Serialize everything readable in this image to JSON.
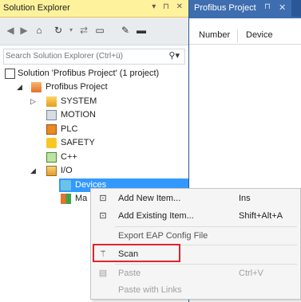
{
  "solution_explorer": {
    "title": "Solution Explorer",
    "title_buttons": "▾ ⊓ ✕",
    "search": {
      "placeholder": "Search Solution Explorer (Ctrl+ü)"
    },
    "tree": {
      "solution": "Solution 'Profibus Project' (1 project)",
      "project": "Profibus Project",
      "system": "SYSTEM",
      "motion": "MOTION",
      "plc": "PLC",
      "safety": "SAFETY",
      "cpp": "C++",
      "io": "I/O",
      "devices": "Devices",
      "mappings": "Ma"
    }
  },
  "profibus_panel": {
    "tab_title": "Profibus Project",
    "columns": [
      "Number",
      "Device"
    ]
  },
  "context_menu": {
    "items": [
      {
        "label": "Add New Item...",
        "shortcut": "Ins",
        "icon": "add-new-item-icon",
        "enabled": true
      },
      {
        "label": "Add Existing Item...",
        "shortcut": "Shift+Alt+A",
        "icon": "add-existing-item-icon",
        "enabled": true
      },
      {
        "label": "Export EAP Config File",
        "shortcut": "",
        "icon": "",
        "enabled": true
      },
      {
        "label": "Scan",
        "shortcut": "",
        "icon": "scan-wand-icon",
        "enabled": true,
        "highlighted": true
      },
      {
        "label": "Paste",
        "shortcut": "Ctrl+V",
        "icon": "paste-icon",
        "enabled": false
      },
      {
        "label": "Paste with Links",
        "shortcut": "",
        "icon": "",
        "enabled": false
      }
    ]
  },
  "colors": {
    "title_bar": "#fff29d",
    "selection": "#3399ff",
    "doc_tab": "#3e6db0",
    "highlight_border": "#e0242a"
  }
}
